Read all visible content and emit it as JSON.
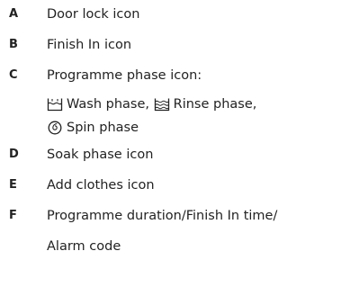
{
  "items": [
    {
      "letter": "A",
      "text": "Door lock icon"
    },
    {
      "letter": "B",
      "text": "Finish In icon"
    },
    {
      "letter": "C",
      "text": "Programme phase icon:"
    },
    {
      "letter": "D",
      "text": "Soak phase icon"
    },
    {
      "letter": "E",
      "text": "Add clothes icon"
    },
    {
      "letter": "F",
      "text": "Programme duration/Finish In time/",
      "text2": "Alarm code"
    }
  ],
  "phases": [
    {
      "icon": "wash-phase-icon",
      "label": "Wash phase,"
    },
    {
      "icon": "rinse-phase-icon",
      "label": "Rinse phase,"
    },
    {
      "icon": "spin-phase-icon",
      "label": "Spin phase"
    }
  ]
}
